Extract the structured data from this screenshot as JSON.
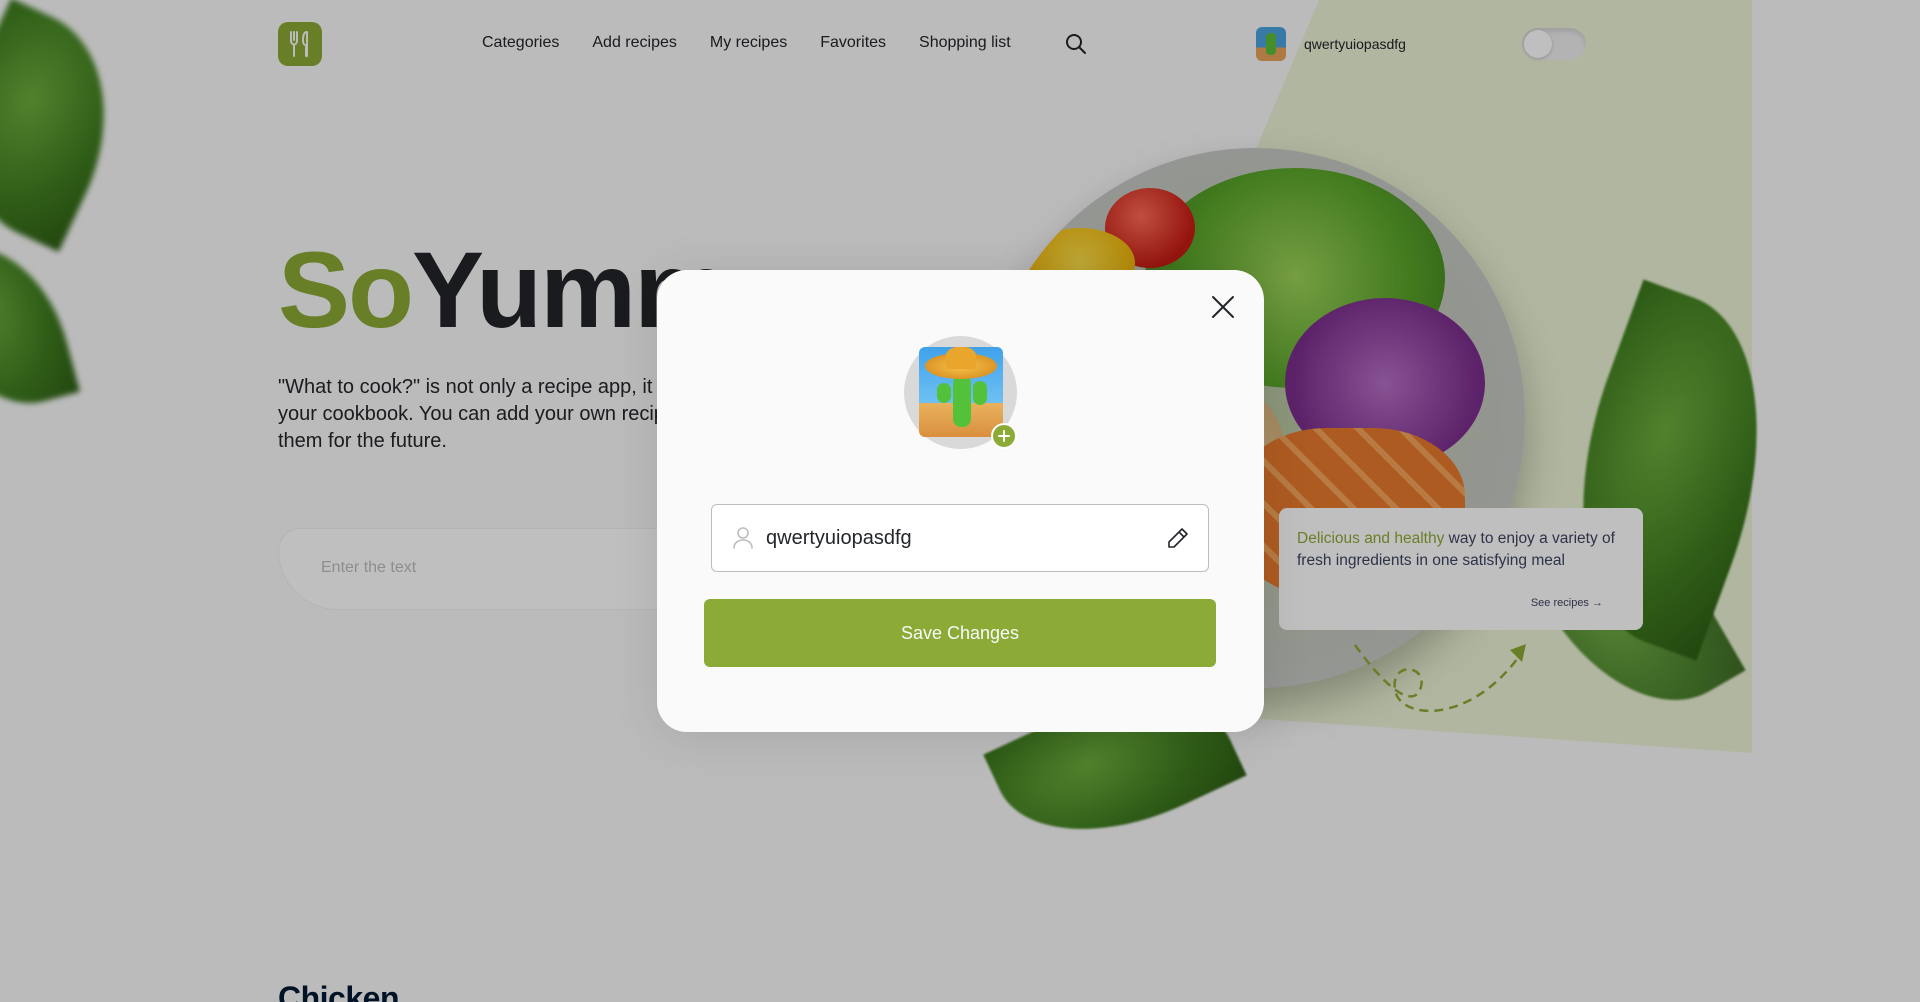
{
  "app": {
    "logo_icon": "fork-knife-icon"
  },
  "nav": {
    "items": [
      {
        "label": "Categories"
      },
      {
        "label": "Add recipes"
      },
      {
        "label": "My recipes"
      },
      {
        "label": "Favorites"
      },
      {
        "label": "Shopping list"
      }
    ],
    "search_icon": "search-icon"
  },
  "user": {
    "name": "qwertyuiopasdfg"
  },
  "theme_toggle": {
    "state": "off"
  },
  "hero": {
    "title_part1": "So",
    "title_part2": "Yummy",
    "text": "\"What to cook?\" is not only a recipe app, it is, in fact, your cookbook. You can add your own recipes to save them for the future.",
    "search_placeholder": "Enter the text"
  },
  "promo": {
    "highlight": "Delicious and healthy",
    "text": " way to enjoy a variety of fresh ingredients in one satisfying meal",
    "link": "See recipes"
  },
  "section": {
    "title": "Chicken"
  },
  "modal": {
    "name_value": "qwertyuiopasdfg",
    "save_label": "Save Changes",
    "close_icon": "close-icon",
    "edit_icon": "pencil-icon",
    "user_icon": "user-icon",
    "add_photo_icon": "plus-icon"
  },
  "colors": {
    "accent": "#8baa36",
    "dark": "#22252a",
    "overlay": "rgba(0,0,0,0.25)"
  }
}
